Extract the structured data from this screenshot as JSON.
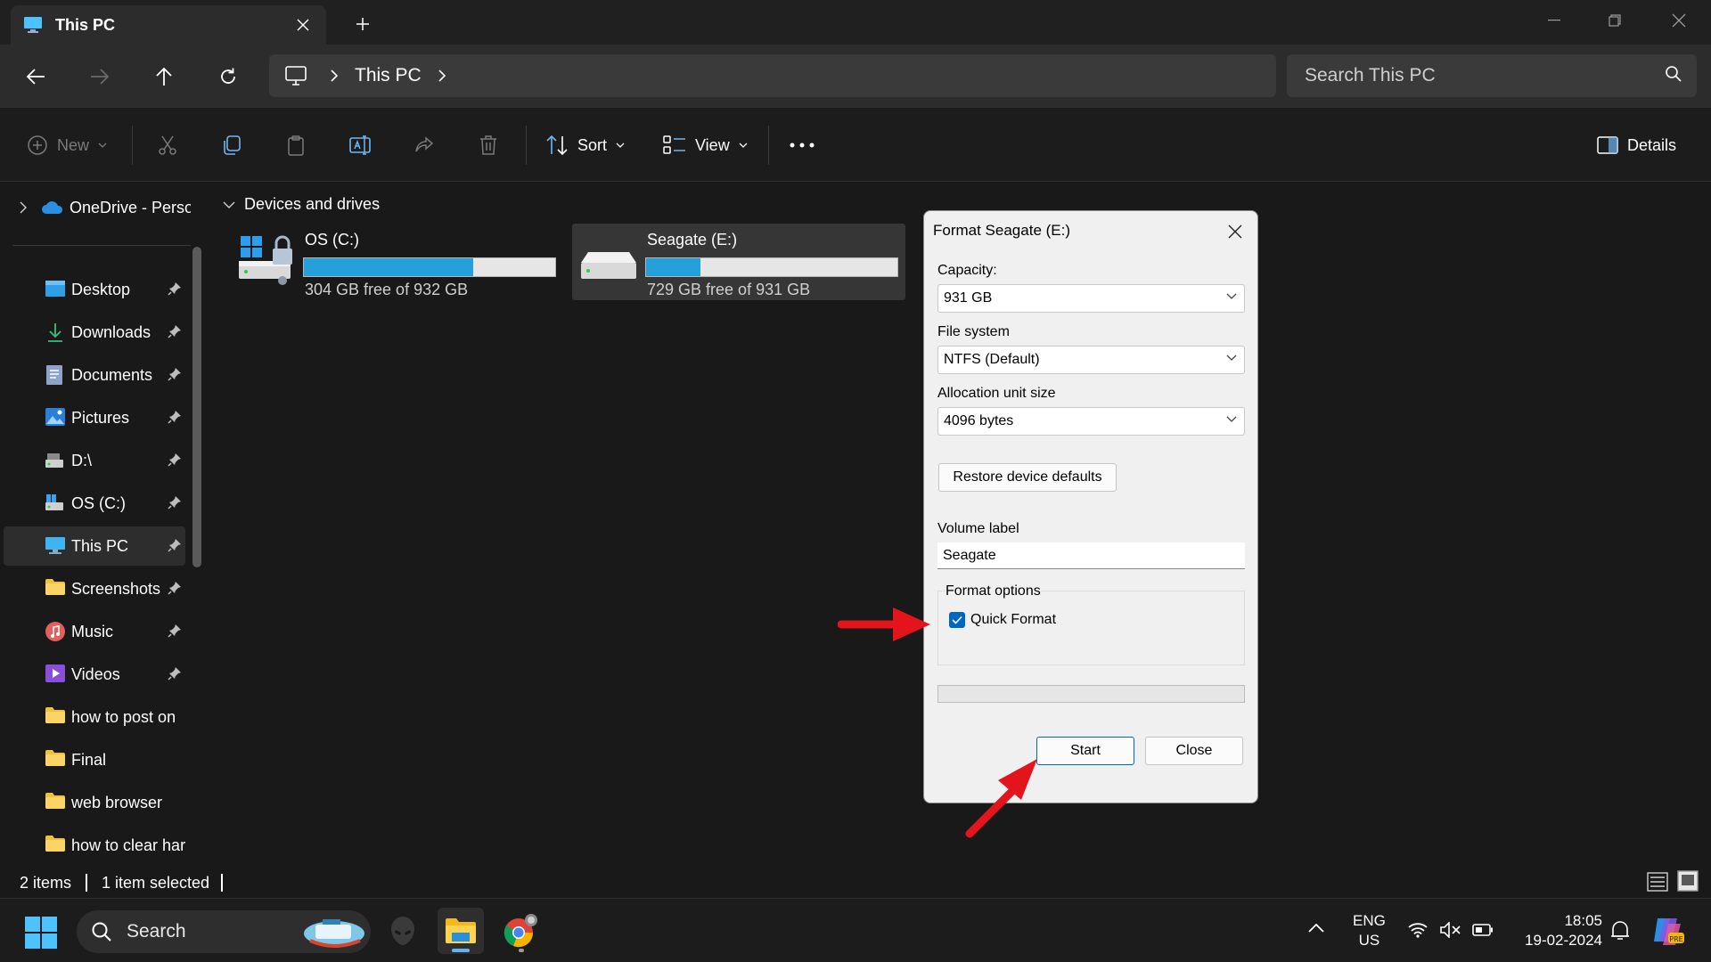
{
  "window": {
    "tab_title": "This PC",
    "breadcrumb": [
      "This PC"
    ],
    "search_placeholder": "Search This PC"
  },
  "toolbar": {
    "new_label": "New",
    "sort_label": "Sort",
    "view_label": "View",
    "details_label": "Details"
  },
  "sidebar": {
    "onedrive_label": "OneDrive - Perso",
    "items": [
      {
        "label": "Desktop",
        "icon": "desktop-icon"
      },
      {
        "label": "Downloads",
        "icon": "download-icon"
      },
      {
        "label": "Documents",
        "icon": "documents-icon"
      },
      {
        "label": "Pictures",
        "icon": "pictures-icon"
      },
      {
        "label": "D:\\",
        "icon": "drive-icon"
      },
      {
        "label": "OS (C:)",
        "icon": "drive-icon"
      },
      {
        "label": "This PC",
        "icon": "pc-icon"
      },
      {
        "label": "Screenshots",
        "icon": "folder-icon"
      },
      {
        "label": "Music",
        "icon": "music-icon"
      },
      {
        "label": "Videos",
        "icon": "videos-icon"
      },
      {
        "label": "how to post on",
        "icon": "folder-icon"
      },
      {
        "label": "Final",
        "icon": "folder-icon"
      },
      {
        "label": "web browser",
        "icon": "folder-icon"
      },
      {
        "label": "how to clear har",
        "icon": "folder-icon"
      }
    ]
  },
  "content": {
    "group_title": "Devices and drives",
    "drives": [
      {
        "name": "OS (C:)",
        "free_text": "304 GB free of 932 GB",
        "used_fraction": 0.674
      },
      {
        "name": "Seagate (E:)",
        "free_text": "729 GB free of 931 GB",
        "used_fraction": 0.217
      }
    ]
  },
  "status": {
    "items_count": "2 items",
    "selected_count": "1 item selected"
  },
  "dialog": {
    "title": "Format Seagate (E:)",
    "capacity_label": "Capacity:",
    "capacity_value": "931 GB",
    "filesystem_label": "File system",
    "filesystem_value": "NTFS (Default)",
    "alloc_label": "Allocation unit size",
    "alloc_value": "4096 bytes",
    "restore_label": "Restore device defaults",
    "volume_label_label": "Volume label",
    "volume_label_value": "Seagate",
    "format_options_label": "Format options",
    "quick_format_label": "Quick Format",
    "quick_format_checked": true,
    "start_label": "Start",
    "close_label": "Close"
  },
  "taskbar": {
    "search_label": "Search",
    "lang_top": "ENG",
    "lang_bottom": "US",
    "time": "18:05",
    "date": "19-02-2024"
  },
  "colors": {
    "accent": "#0067c0",
    "drive_bar_fill": "#26a0da",
    "annotation_arrow": "#e3141b"
  }
}
